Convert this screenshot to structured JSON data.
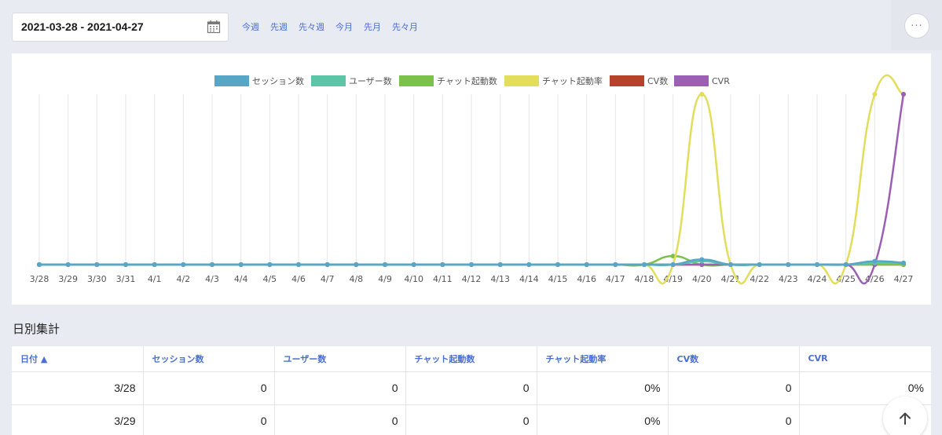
{
  "date_range": {
    "value": "2021-03-28 - 2021-04-27",
    "icon": "calendar-icon"
  },
  "quick_links": [
    "今週",
    "先週",
    "先々週",
    "今月",
    "先月",
    "先々月"
  ],
  "more_button": {
    "label": "···",
    "icon": "more-icon"
  },
  "chart_data": {
    "type": "line",
    "categories": [
      "3/28",
      "3/29",
      "3/30",
      "3/31",
      "4/1",
      "4/2",
      "4/3",
      "4/4",
      "4/5",
      "4/6",
      "4/7",
      "4/8",
      "4/9",
      "4/10",
      "4/11",
      "4/12",
      "4/13",
      "4/14",
      "4/15",
      "4/16",
      "4/17",
      "4/18",
      "4/19",
      "4/20",
      "4/21",
      "4/22",
      "4/23",
      "4/24",
      "4/25",
      "4/26",
      "4/27"
    ],
    "ylim": [
      0,
      100
    ],
    "grid": "vertical",
    "legend": "top-center",
    "series": [
      {
        "name": "セッション数",
        "color": "#58a6c6",
        "values": [
          0,
          0,
          0,
          0,
          0,
          0,
          0,
          0,
          0,
          0,
          0,
          0,
          0,
          0,
          0,
          0,
          0,
          0,
          0,
          0,
          0,
          0,
          0,
          3,
          0,
          0,
          0,
          0,
          0,
          2,
          1
        ]
      },
      {
        "name": "ユーザー数",
        "color": "#5cc5a8",
        "values": [
          0,
          0,
          0,
          0,
          0,
          0,
          0,
          0,
          0,
          0,
          0,
          0,
          0,
          0,
          0,
          0,
          0,
          0,
          0,
          0,
          0,
          0,
          0,
          2,
          0,
          0,
          0,
          0,
          0,
          1,
          1
        ]
      },
      {
        "name": "チャット起動数",
        "color": "#7bc14a",
        "values": [
          0,
          0,
          0,
          0,
          0,
          0,
          0,
          0,
          0,
          0,
          0,
          0,
          0,
          0,
          0,
          0,
          0,
          0,
          0,
          0,
          0,
          0,
          5,
          0,
          0,
          0,
          0,
          0,
          0,
          0,
          0
        ]
      },
      {
        "name": "チャット起動率",
        "color": "#e3dd5c",
        "values": [
          0,
          0,
          0,
          0,
          0,
          0,
          0,
          0,
          0,
          0,
          0,
          0,
          0,
          0,
          0,
          0,
          0,
          0,
          0,
          0,
          0,
          0,
          0,
          100,
          0,
          0,
          0,
          0,
          0,
          100,
          100
        ]
      },
      {
        "name": "CV数",
        "color": "#b5432a",
        "values": [
          0,
          0,
          0,
          0,
          0,
          0,
          0,
          0,
          0,
          0,
          0,
          0,
          0,
          0,
          0,
          0,
          0,
          0,
          0,
          0,
          0,
          0,
          0,
          0,
          0,
          0,
          0,
          0,
          0,
          0,
          0
        ]
      },
      {
        "name": "CVR",
        "color": "#9b5fb4",
        "values": [
          0,
          0,
          0,
          0,
          0,
          0,
          0,
          0,
          0,
          0,
          0,
          0,
          0,
          0,
          0,
          0,
          0,
          0,
          0,
          0,
          0,
          0,
          0,
          0,
          0,
          0,
          0,
          0,
          0,
          0,
          100
        ]
      }
    ]
  },
  "section_title": "日別集計",
  "table": {
    "headers": [
      "日付 ▲",
      "セッション数",
      "ユーザー数",
      "チャット起動数",
      "チャット起動率",
      "CV数",
      "CVR"
    ],
    "rows": [
      [
        "3/28",
        "0",
        "0",
        "0",
        "0%",
        "0",
        "0%"
      ],
      [
        "3/29",
        "0",
        "0",
        "0",
        "0%",
        "0",
        ""
      ]
    ]
  },
  "scroll_top": {
    "label": "↑",
    "icon": "arrow-up-icon"
  }
}
